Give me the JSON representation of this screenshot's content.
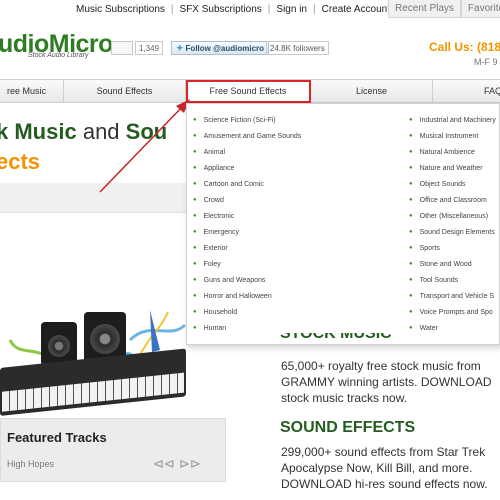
{
  "top_links": [
    "Music Subscriptions",
    "SFX Subscriptions",
    "Sign in",
    "Create Account"
  ],
  "top_tabs": [
    "Recent Plays",
    "Favorite"
  ],
  "logo": {
    "text": "udioMicro",
    "tagline": "Stock Audio Library"
  },
  "social": {
    "like_count": "1,349",
    "follow_label": "Follow @audiomicro",
    "followers": "24.8K followers"
  },
  "contact": {
    "call_us": "Call Us: (818",
    "hours": "M-F 9"
  },
  "nav": {
    "items": [
      "ree Music",
      "Sound Effects",
      "Free Sound Effects",
      "License",
      "FAQ"
    ]
  },
  "hero": {
    "line1_bold": "k Music",
    "line1_and": "and",
    "line1_end": "Sou",
    "line2": "ects"
  },
  "dropdown": {
    "col1": [
      "Science Fiction (Sci-Fi)",
      "Amusement and Game Sounds",
      "Animal",
      "Appliance",
      "Cartoon and Comic",
      "Crowd",
      "Electronic",
      "Emergency",
      "Exterior",
      "Foley",
      "Guns and Weapons",
      "Horror and Halloween",
      "Household",
      "Human"
    ],
    "col2": [
      "Industrial and Machinery",
      "Musical Instrument",
      "Natural Ambience",
      "Nature and Weather",
      "Object Sounds",
      "Office and Classroom",
      "Other (Miscellaneous)",
      "Sound Design Elements",
      "Sports",
      "Stone and Wood",
      "Tool Sounds",
      "Transport and Vehicle S",
      "Voice Prompts and Spo",
      "Water"
    ]
  },
  "stock_music": {
    "heading": "STOCK MUSIC",
    "lines": [
      "65,000+ royalty free stock music from",
      "GRAMMY winning artists. DOWNLOAD",
      "stock music tracks now."
    ]
  },
  "sound_effects": {
    "heading": "SOUND EFFECTS",
    "lines": [
      "299,000+ sound effects from Star Trek",
      "Apocalypse Now, Kill Bill, and more.",
      "DOWNLOAD hi-res sound effects now."
    ]
  },
  "featured": {
    "title": "Featured Tracks",
    "track": "High Hopes"
  },
  "colors": {
    "brand_green": "#2f7d22",
    "accent_orange": "#f29400",
    "highlight_red": "#d9262b"
  }
}
